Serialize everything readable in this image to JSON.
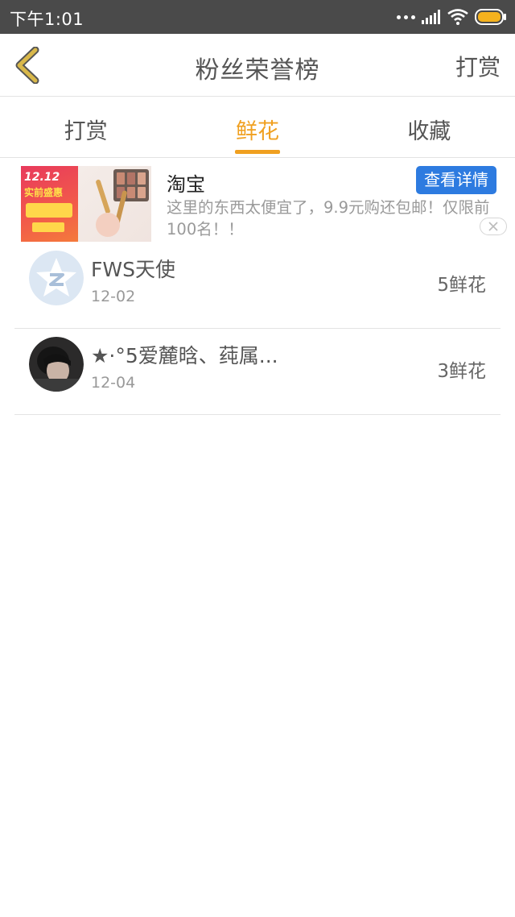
{
  "status_bar": {
    "time": "下午1:01",
    "icons": [
      "dots-icon",
      "signal-icon",
      "wifi-icon",
      "battery-icon"
    ]
  },
  "header": {
    "title": "粉丝荣誉榜",
    "back_icon": "chevron-left-icon",
    "action_label": "打赏"
  },
  "tabs": [
    {
      "label": "打赏",
      "active": false
    },
    {
      "label": "鲜花",
      "active": true
    },
    {
      "label": "收藏",
      "active": false
    }
  ],
  "ad": {
    "title": "淘宝",
    "description": "这里的东西太便宜了，9.9元购还包邮！仅限前100名！！",
    "button_label": "查看详情",
    "image_text": [
      "12.12",
      "实前盛惠"
    ],
    "close_icon": "close-icon"
  },
  "list": [
    {
      "name": "FWS天使",
      "date": "12-02",
      "flowers": "5鲜花",
      "avatar": "default-avatar-icon"
    },
    {
      "name": "★·°5爱麓晗、莼属...",
      "date": "12-04",
      "flowers": "3鲜花",
      "avatar": "user-photo-avatar"
    }
  ],
  "colors": {
    "accent": "#f0a020",
    "status_bar": "#4a4a4a",
    "ad_button": "#2d7be0",
    "back_icon_stroke": "#d9b84a"
  }
}
